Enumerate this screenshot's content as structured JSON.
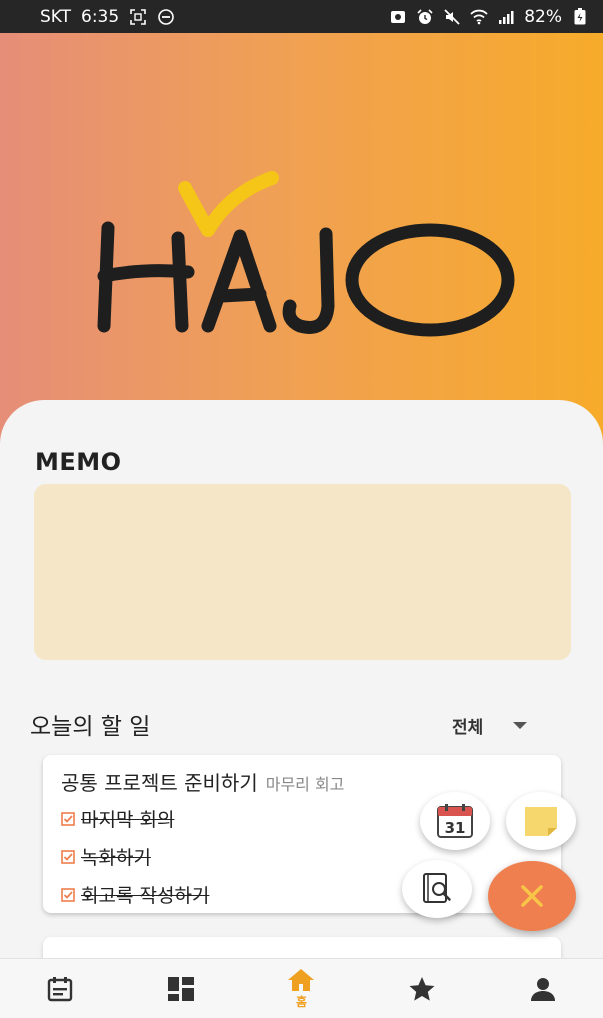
{
  "status_bar": {
    "carrier": "SKT",
    "time": "6:35",
    "battery": "82%",
    "icons_left": [
      "screenshot-icon",
      "dnd-icon"
    ],
    "icons_right": [
      "data-saver-icon",
      "alarm-icon",
      "mute-icon",
      "wifi-icon",
      "signal-icon",
      "battery-icon"
    ]
  },
  "header": {
    "logo_text": "HAJO",
    "colors": {
      "gradient_start": "#e68e78",
      "gradient_end": "#f7ab2a",
      "check": "#f5c518"
    }
  },
  "memo": {
    "title": "MEMO",
    "content": "",
    "box_color": "#f5e6c8"
  },
  "todo": {
    "title": "오늘의 할 일",
    "filter": "전체",
    "cards": [
      {
        "title": "공통 프로젝트 준비하기",
        "subtitle": "마무리 회고",
        "tasks": [
          {
            "label": "마지막 회의",
            "done": true
          },
          {
            "label": "녹화하기",
            "done": true
          },
          {
            "label": "회고록 작성하기",
            "done": true
          }
        ]
      }
    ]
  },
  "fab": {
    "calendar_day": "31",
    "main_color": "#ef7f4e",
    "actions": [
      "calendar-icon",
      "sticky-note-icon",
      "notebook-search-icon"
    ]
  },
  "bottom_nav": {
    "items": [
      {
        "icon": "calendar-list-icon",
        "label": ""
      },
      {
        "icon": "dashboard-icon",
        "label": ""
      },
      {
        "icon": "home-icon",
        "label": "홈",
        "active": true
      },
      {
        "icon": "star-icon",
        "label": ""
      },
      {
        "icon": "person-icon",
        "label": ""
      }
    ],
    "active_color": "#f0a020"
  }
}
